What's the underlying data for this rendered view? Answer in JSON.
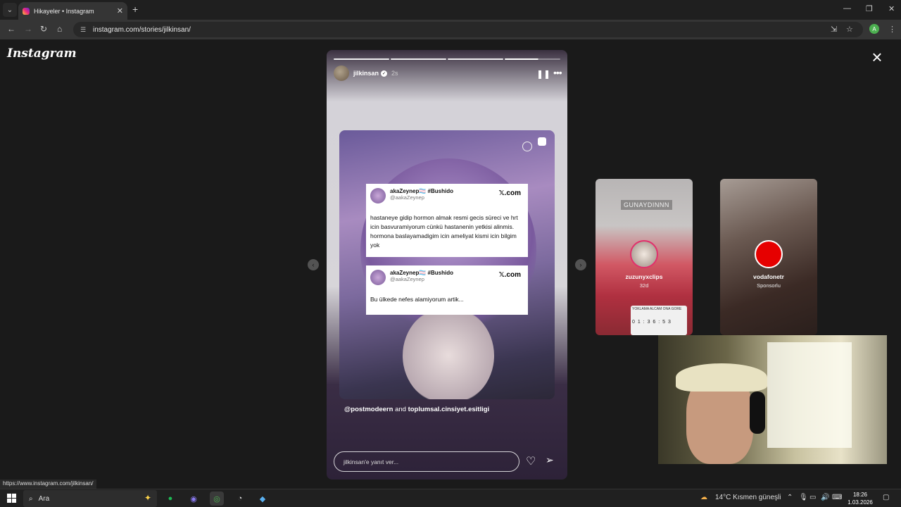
{
  "browser": {
    "tab_title": "Hikayeler • Instagram",
    "tab_close": "✕",
    "new_tab": "+",
    "url": "instagram.com/stories/jilkinsan/",
    "profile_initial": "A",
    "status_url": "https://www.instagram.com/jilkinsan/"
  },
  "instagram": {
    "logo": "Instagram",
    "story": {
      "username": "jilkinsan",
      "time": "2s",
      "tweets": [
        {
          "name": "akaZeynep🏳️‍⚧️ #Bushido",
          "handle": "@aakaZeynep",
          "brand": "𝕏.com",
          "text": "hastaneye gidip hormon almak resmi gecis süreci ve hrt icin basvuramiyorum cünkü hastanenin yetkisi alinmis. hormona baslayamadigim icin ameliyat kismi icin bilgim yok"
        },
        {
          "name": "akaZeynep🏳️‍⚧️ #Bushido",
          "handle": "@aakaZeynep",
          "brand": "𝕏.com",
          "text": "Bu ülkede nefes alamiyorum artik..."
        }
      ],
      "mention_1": "@postmodeern",
      "mention_join": " and ",
      "mention_2": "toplumsal.cinsiyet.esitligi",
      "reply_placeholder": "jilkinsan'e yanıt ver..."
    },
    "previews": [
      {
        "tag": "GUNAYDINNN",
        "name": "zuzunyxclips",
        "sub": "32d",
        "sticker_title": "YOKLAMA ALCAM ONA GORE",
        "sticker_counter": "0 1 : 3 6 : 5 3"
      },
      {
        "name": "vodafonetr",
        "sub": "Sponsorlu"
      }
    ]
  },
  "taskbar": {
    "search_placeholder": "Ara",
    "weather": "14°C  Kısmen güneşli",
    "time": "18:26",
    "date": "1.03.2026"
  }
}
